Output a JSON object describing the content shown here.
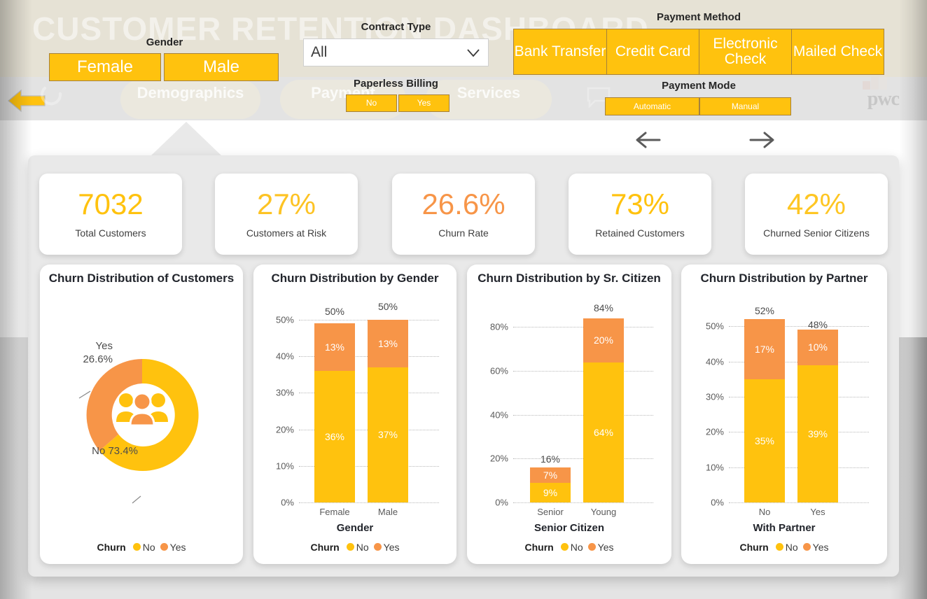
{
  "header": {
    "watermark": "CUSTOMER RETENTION DASHBOARD",
    "nav_items": [
      {
        "label": "Demographics"
      },
      {
        "label": "Payment"
      },
      {
        "label": "Services"
      }
    ],
    "brand": "pwc",
    "back_arrow_name": "back-arrow-icon",
    "refresh_icon_name": "refresh-icon",
    "comment_icon_name": "comment-icon"
  },
  "filters": {
    "gender": {
      "label": "Gender",
      "options": [
        "Female",
        "Male"
      ]
    },
    "contract_type": {
      "label": "Contract Type",
      "value": "All",
      "options": [
        "All"
      ]
    },
    "paperless_billing": {
      "label": "Paperless Billing",
      "options": [
        "No",
        "Yes"
      ]
    },
    "payment_method": {
      "label": "Payment Method",
      "options": [
        "Bank Transfer",
        "Credit Card",
        "Electronic Check",
        "Mailed Check"
      ]
    },
    "payment_mode": {
      "label": "Payment Mode",
      "options": [
        "Automatic",
        "Manual"
      ]
    }
  },
  "pager": {
    "prev": "previous-page-arrow",
    "next": "next-page-arrow"
  },
  "kpis": [
    {
      "value": "7032",
      "label": "Total Customers",
      "color": "#FFC20E"
    },
    {
      "value": "27%",
      "label": "Customers at Risk",
      "color": "#FDC324"
    },
    {
      "value": "26.6%",
      "label": "Churn Rate",
      "color": "#F79548"
    },
    {
      "value": "73%",
      "label": "Retained Customers",
      "color": "#FFC20E"
    },
    {
      "value": "42%",
      "label": "Churned Senior Citizens",
      "color": "#FEC623"
    }
  ],
  "legend": {
    "title": "Churn",
    "items": [
      {
        "label": "No",
        "color": "#FFC20E"
      },
      {
        "label": "Yes",
        "color": "#F79548"
      }
    ]
  },
  "colors": {
    "no": "#FFC20E",
    "yes": "#F79548",
    "header_bg": "#E6E2D5",
    "panel_bg": "#E9E9E9",
    "band_bg": "#E4E4E4"
  },
  "chart_data": [
    {
      "type": "pie",
      "title": "Churn Distribution of Customers",
      "labels": [
        "No",
        "Yes"
      ],
      "values": [
        73.4,
        26.6
      ],
      "value_labels": [
        "No 73.4%",
        "Yes\n26.6%"
      ],
      "colors": [
        "#FFC20E",
        "#F79548"
      ],
      "legend_title": "Churn",
      "legend": [
        "No",
        "Yes"
      ],
      "center_icon": "people-group-icon"
    },
    {
      "type": "bar",
      "title": "Churn Distribution by Gender",
      "stacked": true,
      "categories": [
        "Female",
        "Male"
      ],
      "series": [
        {
          "name": "No",
          "values": [
            36,
            37
          ],
          "color": "#FFC20E"
        },
        {
          "name": "Yes",
          "values": [
            13,
            13
          ],
          "color": "#F79548"
        }
      ],
      "totals": [
        50,
        50
      ],
      "xlabel": "Gender",
      "ylabel": "",
      "ylim": [
        0,
        54
      ],
      "yticks": [
        0,
        10,
        20,
        30,
        40,
        50
      ],
      "ytick_labels": [
        "0%",
        "10%",
        "20%",
        "30%",
        "40%",
        "50%"
      ],
      "grid": true,
      "legend_title": "Churn",
      "legend": [
        "No",
        "Yes"
      ]
    },
    {
      "type": "bar",
      "title": "Churn Distribution by Sr. Citizen",
      "stacked": true,
      "categories": [
        "Senior",
        "Young"
      ],
      "series": [
        {
          "name": "No",
          "values": [
            9,
            64
          ],
          "color": "#FFC20E"
        },
        {
          "name": "Yes",
          "values": [
            7,
            20
          ],
          "color": "#F79548"
        }
      ],
      "totals": [
        16,
        84
      ],
      "xlabel": "Senior Citizen",
      "ylabel": "",
      "ylim": [
        0,
        90
      ],
      "yticks": [
        0,
        20,
        40,
        60,
        80
      ],
      "ytick_labels": [
        "0%",
        "20%",
        "40%",
        "60%",
        "80%"
      ],
      "grid": true,
      "legend_title": "Churn",
      "legend": [
        "No",
        "Yes"
      ]
    },
    {
      "type": "bar",
      "title": "Churn Distribution by Partner",
      "stacked": true,
      "categories": [
        "No",
        "Yes"
      ],
      "series": [
        {
          "name": "No",
          "values": [
            35,
            39
          ],
          "color": "#FFC20E"
        },
        {
          "name": "Yes",
          "values": [
            17,
            10
          ],
          "color": "#F79548"
        }
      ],
      "totals": [
        52,
        48
      ],
      "xlabel": "With Partner",
      "ylabel": "",
      "ylim": [
        0,
        56
      ],
      "yticks": [
        0,
        10,
        20,
        30,
        40,
        50
      ],
      "ytick_labels": [
        "0%",
        "10%",
        "20%",
        "30%",
        "40%",
        "50%"
      ],
      "grid": true,
      "legend_title": "Churn",
      "legend": [
        "No",
        "Yes"
      ]
    }
  ]
}
